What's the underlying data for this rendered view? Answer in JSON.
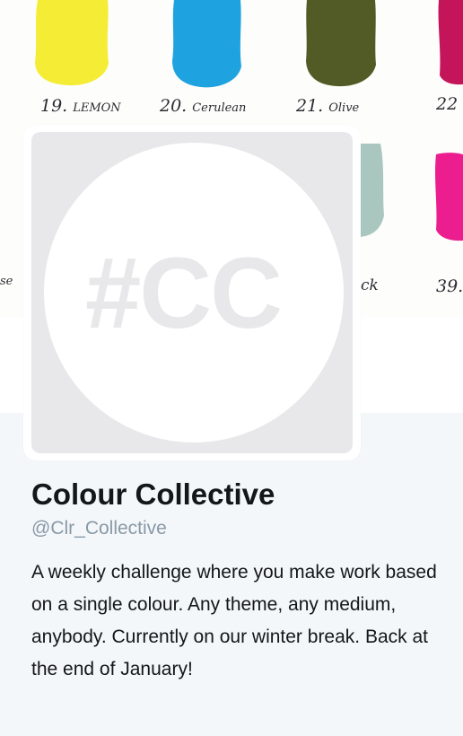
{
  "banner": {
    "swatches": [
      {
        "number": "19.",
        "name": "LEMON",
        "color": "#f5ed35"
      },
      {
        "number": "20.",
        "name": "Cerulean",
        "color": "#1ea3e0"
      },
      {
        "number": "21.",
        "name": "Olive",
        "color": "#525b25"
      },
      {
        "number": "22",
        "name": "",
        "color": "#c4155a"
      },
      {
        "number": "",
        "name": "se",
        "color": "#ffffff"
      },
      {
        "number": "",
        "name": "ck",
        "color": "#a9c6bf"
      },
      {
        "number": "39.",
        "name": "",
        "color": "#ec1e8f"
      }
    ]
  },
  "profile": {
    "avatar_text": "#CC",
    "name": "Colour Collective",
    "handle": "@Clr_Collective",
    "bio": "A weekly challenge where you make work based on a single colour. Any theme, any medium, anybody. Currently on our winter break. Back at the end of January!"
  },
  "colors": {
    "background": "#f4f7fa",
    "name_text": "#14171a",
    "handle_text": "#8899a6",
    "avatar_grey": "#e8e7e9"
  }
}
